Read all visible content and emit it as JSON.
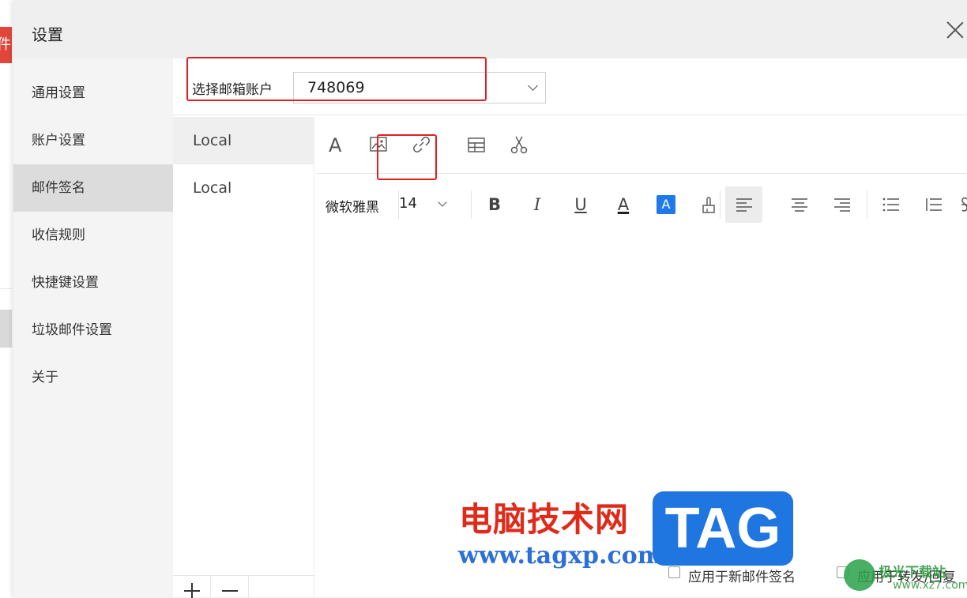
{
  "background": {
    "edge_text": "件"
  },
  "dialog": {
    "title": "设置",
    "close": "×"
  },
  "nav": {
    "items": [
      {
        "label": "通用设置"
      },
      {
        "label": "账户设置"
      },
      {
        "label": "邮件签名"
      },
      {
        "label": "收信规则"
      },
      {
        "label": "快捷键设置"
      },
      {
        "label": "垃圾邮件设置"
      },
      {
        "label": "关于"
      }
    ],
    "active_index": 2
  },
  "account": {
    "label": "选择邮箱账户",
    "value": "748069"
  },
  "signatures": {
    "items": [
      {
        "label": "Local"
      },
      {
        "label": "Local"
      }
    ],
    "active_index": 0
  },
  "toolbar": {
    "font_icon": "A",
    "bold": "B",
    "italic": "I",
    "underline": "U",
    "font_color": "A",
    "highlight": "A"
  },
  "format": {
    "font_name": "微软雅黑",
    "font_size": "14"
  },
  "options": {
    "apply_new": "应用于新邮件签名",
    "apply_reply": "应用于转发/回复"
  },
  "watermark": {
    "brand_cn": "电脑技术网",
    "url": "www.tagxp.com",
    "tag": "TAG",
    "site_cn": "极光下载站",
    "site_url": "www.xz7.com"
  },
  "colors": {
    "highlight_red": "#e02020",
    "accent_blue": "#1f76e0"
  }
}
